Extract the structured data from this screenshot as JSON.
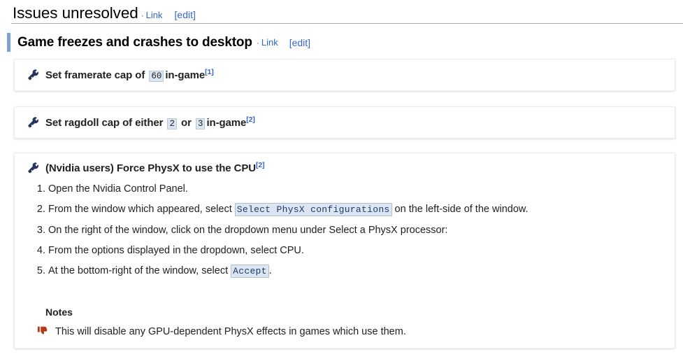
{
  "page": {
    "heading": "Issues unresolved",
    "heading_link_label": "Link",
    "heading_edit_label": "[edit]",
    "separator_dot": "·"
  },
  "section": {
    "title": "Game freezes and crashes to desktop",
    "link_label": "Link",
    "edit_label": "[edit]"
  },
  "fixes": [
    {
      "icon": "wrench-icon",
      "title_before": "Set framerate cap of",
      "value": "60",
      "title_after": "in-game",
      "reference": "[1]"
    },
    {
      "icon": "wrench-icon",
      "title_before": "Set ragdoll cap of either",
      "value1": "2",
      "between": "or",
      "value2": "3",
      "title_after": "in-game",
      "reference": "[2]"
    },
    {
      "icon": "wrench-icon",
      "title": "(Nvidia users) Force PhysX to use the CPU",
      "reference": "[2]",
      "steps": [
        {
          "text": "Open the Nvidia Control Panel."
        },
        {
          "before": "From the window which appeared, select",
          "code": "Select PhysX configurations",
          "after": "on the left-side of the window."
        },
        {
          "text": "On the right of the window, click on the dropdown menu under Select a PhysX processor:"
        },
        {
          "text": "From the options displayed in the dropdown, select CPU."
        },
        {
          "before": "At the bottom-right of the window, select",
          "code": "Accept",
          "after": "."
        }
      ],
      "notes_title": "Notes",
      "notes": [
        {
          "icon": "thumbs-down-icon",
          "text": "This will disable any GPU-dependent PhysX effects in games which use them."
        }
      ]
    }
  ],
  "colors": {
    "link": "#3366cc",
    "accent_bar": "#7ba2d0",
    "wrench": "#25355e",
    "thumbs_down": "#b5381a",
    "code_bg": "#dce6f2",
    "rule": "#a2a9b1"
  }
}
